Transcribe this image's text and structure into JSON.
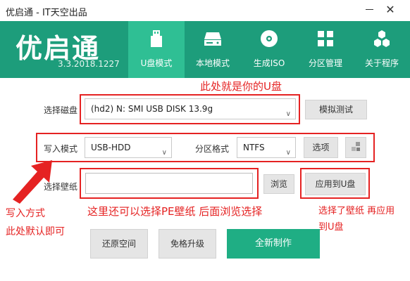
{
  "window": {
    "title": "优启通 - IT天空出品",
    "close_glyph": "✕"
  },
  "header": {
    "logo": "优启通",
    "version": "3.3.2018.1227",
    "tabs": [
      {
        "label": "U盘模式",
        "icon": "usb-icon",
        "active": true
      },
      {
        "label": "本地模式",
        "icon": "hard-drive-icon",
        "active": false
      },
      {
        "label": "生成ISO",
        "icon": "disc-icon",
        "active": false
      },
      {
        "label": "分区管理",
        "icon": "grid-icon",
        "active": false
      },
      {
        "label": "关于程序",
        "icon": "cubes-icon",
        "active": false
      }
    ]
  },
  "disk": {
    "label": "选择磁盘",
    "value": "(hd2) N: SMI USB DISK 13.9g",
    "simulate_button": "模拟测试"
  },
  "write": {
    "mode_label": "写入模式",
    "mode_value": "USB-HDD",
    "format_label": "分区格式",
    "format_value": "NTFS",
    "options_button": "选项"
  },
  "wallpaper": {
    "label": "选择壁纸",
    "value": "",
    "browse_button": "浏览",
    "apply_button": "应用到U盘"
  },
  "actions": {
    "restore": "还原空间",
    "upgrade": "免格升级",
    "create": "全新制作"
  },
  "annotations": {
    "disk_note": "此处就是你的U盘",
    "write_note_1": "写入方式",
    "write_note_2": "此处默认即可",
    "wallpaper_note": "这里还可以选择PE壁纸 后面浏览选择",
    "apply_note_1": "选择了壁纸 再应用",
    "apply_note_2": "到U盘"
  },
  "colors": {
    "header": "#1d9d7b",
    "active_tab": "#2fbf94",
    "annotation": "#e52222",
    "primary_button": "#1fae84"
  }
}
